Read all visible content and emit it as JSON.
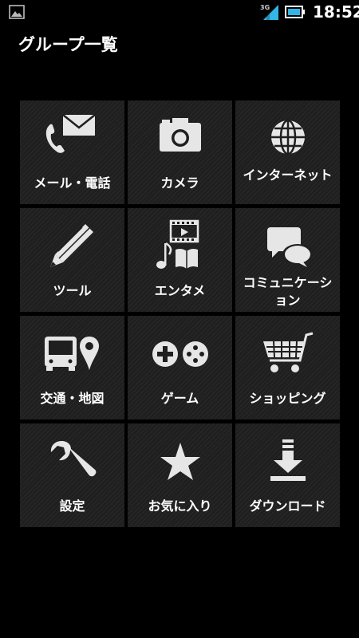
{
  "status_bar": {
    "network_label": "3G",
    "time": "18:52",
    "left_icon": "image-icon",
    "signal_icon": "signal-icon",
    "battery_icon": "battery-icon"
  },
  "header": {
    "title": "グループ一覧"
  },
  "tiles": [
    {
      "label": "メール・電話",
      "icon": "mail-phone-icon"
    },
    {
      "label": "カメラ",
      "icon": "camera-icon"
    },
    {
      "label": "インターネット",
      "icon": "globe-icon"
    },
    {
      "label": "ツール",
      "icon": "pencil-icon"
    },
    {
      "label": "エンタメ",
      "icon": "entertainment-icon"
    },
    {
      "label": "コミュニケーション",
      "icon": "chat-icon"
    },
    {
      "label": "交通・地図",
      "icon": "bus-map-icon"
    },
    {
      "label": "ゲーム",
      "icon": "gamepad-icon"
    },
    {
      "label": "ショッピング",
      "icon": "cart-icon"
    },
    {
      "label": "設定",
      "icon": "wrench-icon"
    },
    {
      "label": "お気に入り",
      "icon": "star-icon"
    },
    {
      "label": "ダウンロード",
      "icon": "download-icon"
    }
  ],
  "colors": {
    "background": "#000000",
    "tile": "#1f1f1f",
    "icon": "#e6e6e6",
    "signal_accent": "#33b5e5"
  }
}
